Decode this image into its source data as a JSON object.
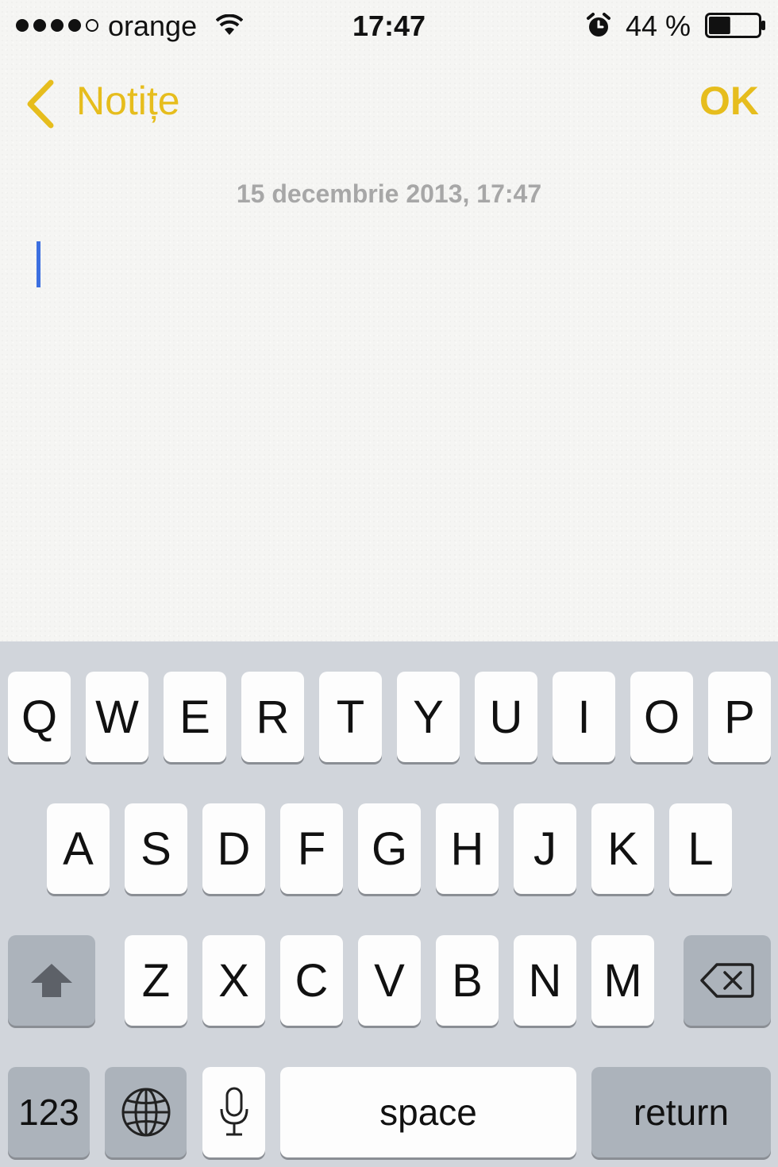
{
  "status_bar": {
    "signal_bars_filled": 4,
    "signal_bars_total": 5,
    "carrier": "orange",
    "time": "17:47",
    "battery_percent_text": "44 %",
    "battery_level": 0.44,
    "icons": [
      "wifi-icon",
      "alarm-icon",
      "battery-icon"
    ]
  },
  "nav": {
    "back_label": "Notițe",
    "done_label": "OK",
    "accent_color": "#e6bd1d"
  },
  "note": {
    "date": "15 decembrie 2013, 17:47",
    "body": "",
    "cursor_color": "#3c6fe0"
  },
  "keyboard": {
    "row1": [
      "Q",
      "W",
      "E",
      "R",
      "T",
      "Y",
      "U",
      "I",
      "O",
      "P"
    ],
    "row2": [
      "A",
      "S",
      "D",
      "F",
      "G",
      "H",
      "J",
      "K",
      "L"
    ],
    "row3": [
      "Z",
      "X",
      "C",
      "V",
      "B",
      "N",
      "M"
    ],
    "shift_icon": "shift-icon",
    "backspace_icon": "backspace-icon",
    "numbers_label": "123",
    "globe_icon": "globe-icon",
    "mic_icon": "microphone-icon",
    "space_label": "space",
    "return_label": "return"
  }
}
